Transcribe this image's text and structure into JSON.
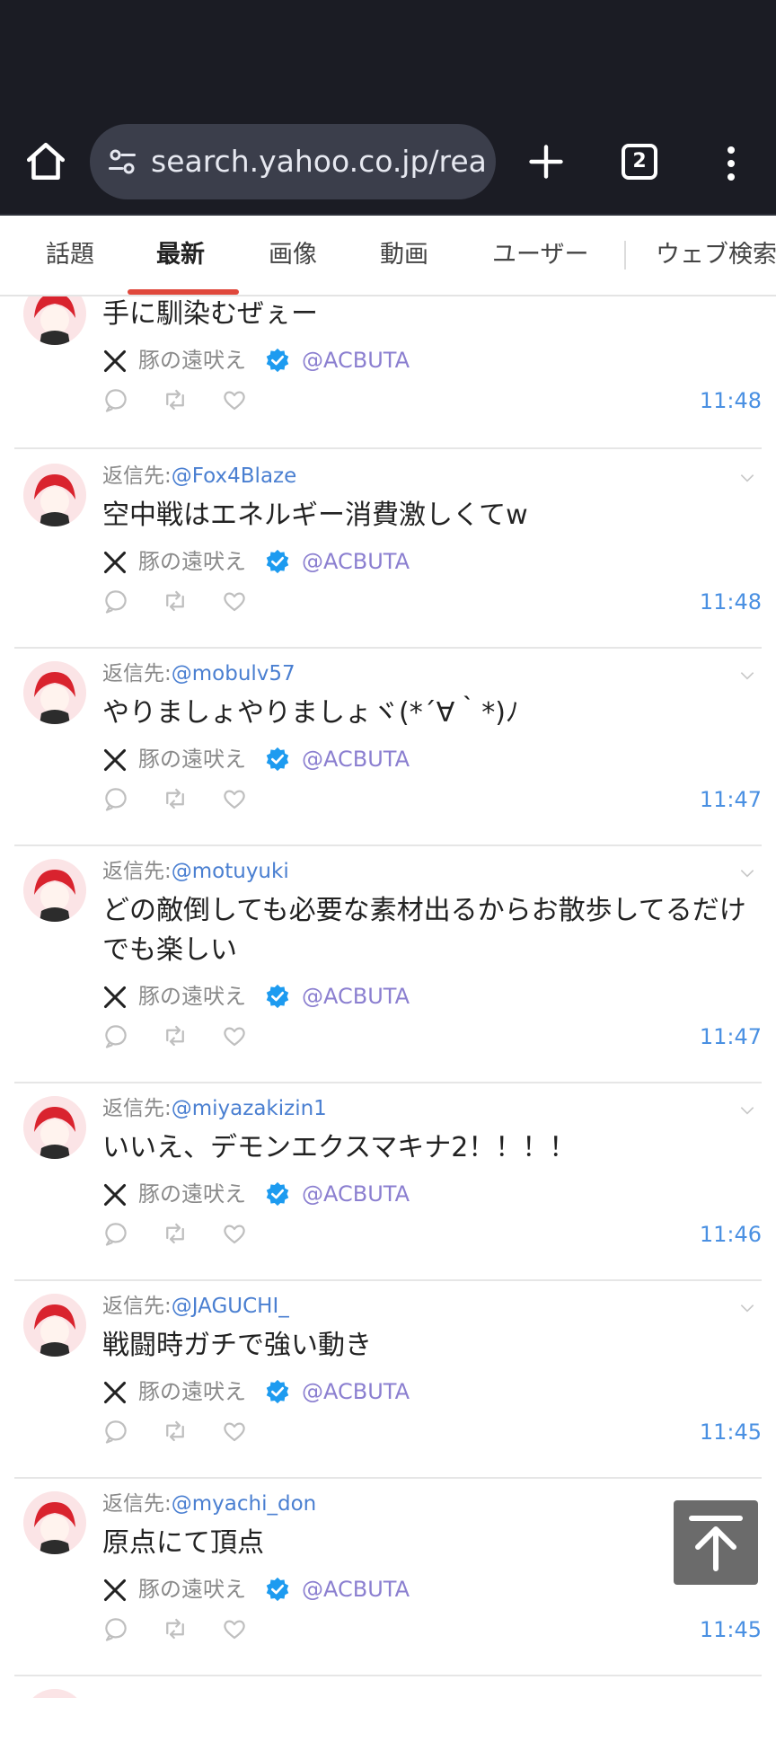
{
  "browser": {
    "url_text": "search.yahoo.co.jp/realt",
    "tab_count": "2"
  },
  "tabs": [
    {
      "label": "話題"
    },
    {
      "label": "最新"
    },
    {
      "label": "画像"
    },
    {
      "label": "動画"
    },
    {
      "label": "ユーザー"
    },
    {
      "label": "ウェブ検索"
    }
  ],
  "active_tab": "最新",
  "reply_prefix": "返信先:",
  "tweets": [
    {
      "reply_to": "",
      "text": "手に馴染むぜぇー",
      "author": "豚の遠吠え",
      "handle": "@ACBUTA",
      "time": "11:48"
    },
    {
      "reply_to": "@Fox4Blaze",
      "text": "空中戦はエネルギー消費激しくてw",
      "author": "豚の遠吠え",
      "handle": "@ACBUTA",
      "time": "11:48"
    },
    {
      "reply_to": "@mobulv57",
      "text": "やりましょやりましょヾ(*´∀｀*)ﾉ",
      "author": "豚の遠吠え",
      "handle": "@ACBUTA",
      "time": "11:47"
    },
    {
      "reply_to": "@motuyuki",
      "text": "どの敵倒しても必要な素材出るからお散歩してるだけでも楽しい",
      "author": "豚の遠吠え",
      "handle": "@ACBUTA",
      "time": "11:47"
    },
    {
      "reply_to": "@miyazakizin1",
      "text": "いいえ、デモンエクスマキナ2！！！！",
      "author": "豚の遠吠え",
      "handle": "@ACBUTA",
      "time": "11:46"
    },
    {
      "reply_to": "@JAGUCHI_",
      "text": "戦闘時ガチで強い動き",
      "author": "豚の遠吠え",
      "handle": "@ACBUTA",
      "time": "11:45"
    },
    {
      "reply_to": "@myachi_don",
      "text": "原点にて頂点",
      "author": "豚の遠吠え",
      "handle": "@ACBUTA",
      "time": "11:45"
    }
  ],
  "colors": {
    "chrome_bg": "#1b1c24",
    "urlbar_bg": "#3b3e4b",
    "active_tab_underline": "#e0483c",
    "link_blue": "#4a7fd1",
    "time_blue": "#4a90e2",
    "handle_purple": "#8b7fd0",
    "verified_blue": "#1d9bf0"
  }
}
